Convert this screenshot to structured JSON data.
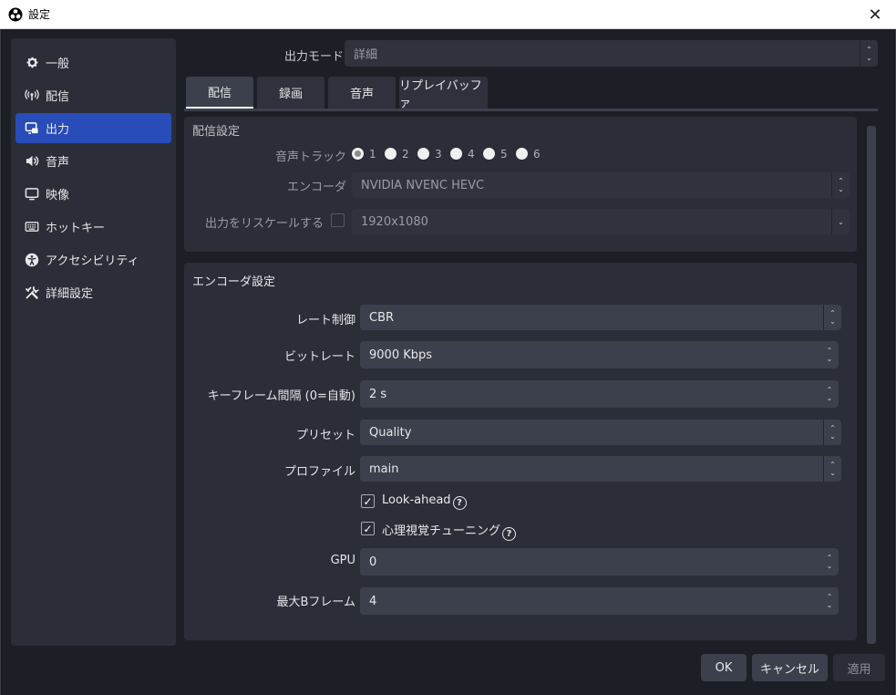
{
  "window": {
    "title": "設定",
    "close_glyph": "✕"
  },
  "sidebar": {
    "items": [
      {
        "label": "一般",
        "icon": "gear-icon",
        "active": false
      },
      {
        "label": "配信",
        "icon": "antenna-icon",
        "active": false
      },
      {
        "label": "出力",
        "icon": "output-icon",
        "active": true
      },
      {
        "label": "音声",
        "icon": "speaker-icon",
        "active": false
      },
      {
        "label": "映像",
        "icon": "monitor-icon",
        "active": false
      },
      {
        "label": "ホットキー",
        "icon": "keyboard-icon",
        "active": false
      },
      {
        "label": "アクセシビリティ",
        "icon": "accessibility-icon",
        "active": false
      },
      {
        "label": "詳細設定",
        "icon": "tools-icon",
        "active": false
      }
    ]
  },
  "output_mode": {
    "label": "出力モード",
    "value": "詳細"
  },
  "tabs": [
    {
      "label": "配信",
      "active": true
    },
    {
      "label": "録画",
      "active": false
    },
    {
      "label": "音声",
      "active": false
    },
    {
      "label": "リプレイバッファ",
      "active": false
    }
  ],
  "stream_settings": {
    "title": "配信設定",
    "audio_track_label": "音声トラック",
    "tracks": [
      "1",
      "2",
      "3",
      "4",
      "5",
      "6"
    ],
    "selected_track": "1",
    "encoder_label": "エンコーダ",
    "encoder_value": "NVIDIA NVENC HEVC",
    "rescale_label": "出力をリスケールする",
    "rescale_value": "1920x1080"
  },
  "encoder_settings": {
    "title": "エンコーダ設定",
    "rate_control_label": "レート制御",
    "rate_control_value": "CBR",
    "bitrate_label": "ビットレート",
    "bitrate_value": "9000 Kbps",
    "keyframe_label": "キーフレーム間隔 (0=自動)",
    "keyframe_value": "2 s",
    "preset_label": "プリセット",
    "preset_value": "Quality",
    "profile_label": "プロファイル",
    "profile_value": "main",
    "lookahead_label": "Look-ahead",
    "psycho_label": "心理視覚チューニング",
    "gpu_label": "GPU",
    "gpu_value": "0",
    "bframes_label": "最大Bフレーム",
    "bframes_value": "4"
  },
  "buttons": {
    "ok": "OK",
    "cancel": "キャンセル",
    "apply": "適用"
  },
  "glyphs": {
    "up": "⌃",
    "down": "⌄",
    "check": "✓",
    "help": "?"
  }
}
